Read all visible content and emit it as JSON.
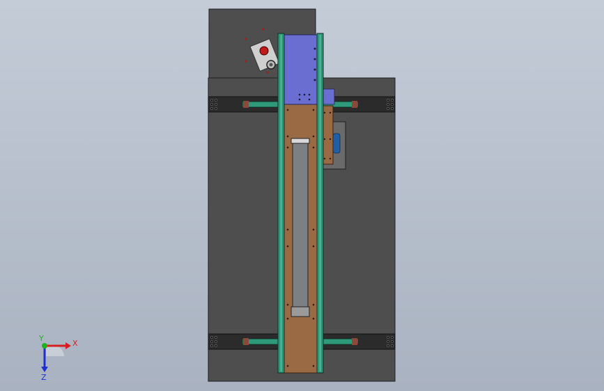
{
  "viewport": {
    "colors": {
      "background_top": "#c4ccd8",
      "background_bottom": "#a9b2c0",
      "housing": "#4e4e4e",
      "housing_edge": "#1e1e1e",
      "rail_green": "#2f9a7a",
      "carriage_blue": "#6a6ed0",
      "plate_brown": "#9a6a45",
      "slot_grey": "#7c7f84",
      "knob_red": "#c01a1a"
    }
  },
  "triad": {
    "x_label": "X",
    "y_label": "Y",
    "z_label": "Z",
    "colors": {
      "x": "#d42020",
      "y": "#20b020",
      "z": "#2030d0"
    }
  }
}
